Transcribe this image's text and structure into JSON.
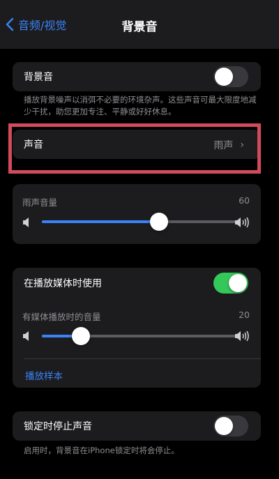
{
  "nav": {
    "back_label": "音频/视觉",
    "title": "背景音"
  },
  "background_sounds": {
    "label": "背景音",
    "enabled": false,
    "footnote": "播放背景噪声以消弭不必要的环境杂声。这些声音可最大限度地减少干扰，助您更加专注、平静或好好休息。"
  },
  "sound": {
    "label": "声音",
    "value": "雨声"
  },
  "volume": {
    "label": "雨声音量",
    "value": "60",
    "level": 0.6
  },
  "media": {
    "label": "在播放媒体时使用",
    "enabled": true,
    "volume_label": "有媒体播放时的音量",
    "volume_value": "20",
    "volume_level": 0.2,
    "sample_label": "播放样本"
  },
  "lock": {
    "label": "锁定时停止声音",
    "enabled": false,
    "footnote": "启用时，背景音在iPhone锁定时将会停止。"
  },
  "colors": {
    "accent": "#3b82f6",
    "toggle_on": "#34c759",
    "highlight": "#d24b5b"
  }
}
